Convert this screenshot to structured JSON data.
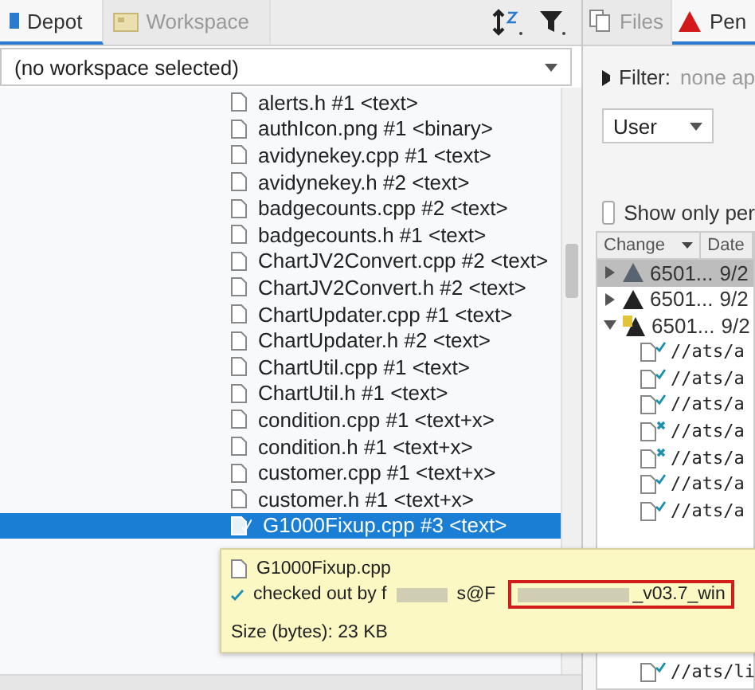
{
  "depot_panel": {
    "tabs": [
      {
        "label": "Depot",
        "selected": true,
        "kind": "depot"
      },
      {
        "label": "Workspace",
        "selected": false,
        "kind": "workspace"
      }
    ],
    "workspace_select": {
      "value": "(no workspace selected)"
    },
    "files": [
      {
        "name": "alerts.h #1 <text>",
        "selected": false,
        "checked_out": false
      },
      {
        "name": "authIcon.png #1 <binary>",
        "selected": false,
        "checked_out": false
      },
      {
        "name": "avidynekey.cpp #1 <text>",
        "selected": false,
        "checked_out": false
      },
      {
        "name": "avidynekey.h #2 <text>",
        "selected": false,
        "checked_out": false
      },
      {
        "name": "badgecounts.cpp #2 <text>",
        "selected": false,
        "checked_out": false
      },
      {
        "name": "badgecounts.h #1 <text>",
        "selected": false,
        "checked_out": false
      },
      {
        "name": "ChartJV2Convert.cpp #2 <text>",
        "selected": false,
        "checked_out": false
      },
      {
        "name": "ChartJV2Convert.h #2 <text>",
        "selected": false,
        "checked_out": false
      },
      {
        "name": "ChartUpdater.cpp #1 <text>",
        "selected": false,
        "checked_out": false
      },
      {
        "name": "ChartUpdater.h #2 <text>",
        "selected": false,
        "checked_out": false
      },
      {
        "name": "ChartUtil.cpp #1 <text>",
        "selected": false,
        "checked_out": false
      },
      {
        "name": "ChartUtil.h #1 <text>",
        "selected": false,
        "checked_out": false
      },
      {
        "name": "condition.cpp #1 <text+x>",
        "selected": false,
        "checked_out": false
      },
      {
        "name": "condition.h #1 <text+x>",
        "selected": false,
        "checked_out": false
      },
      {
        "name": "customer.cpp #1 <text+x>",
        "selected": false,
        "checked_out": false
      },
      {
        "name": "customer.h #1 <text+x>",
        "selected": false,
        "checked_out": false
      },
      {
        "name": "G1000Fixup.cpp #3 <text>",
        "selected": true,
        "checked_out": true
      }
    ],
    "tooltip": {
      "file": "G1000Fixup.cpp",
      "checked_out_prefix": "checked out by f",
      "checked_out_mid": "s@F",
      "checked_out_suffix": "_v03.7_win",
      "size": "Size (bytes): 23 KB"
    }
  },
  "pending_panel": {
    "tabs": [
      {
        "label": "Files",
        "selected": false,
        "kind": "files"
      },
      {
        "label": "Pen",
        "selected": true,
        "kind": "pending"
      }
    ],
    "filter": {
      "label": "Filter:",
      "value": "none ap"
    },
    "user_select": {
      "value": "User"
    },
    "show_only": {
      "label": "Show only per",
      "checked": false
    },
    "columns": [
      "Change",
      "Date"
    ],
    "changes": [
      {
        "number": "6501...",
        "date": "9/2",
        "selected": true,
        "expanded": false,
        "kind": "plain"
      },
      {
        "number": "6501...",
        "date": "9/2",
        "selected": false,
        "expanded": false,
        "kind": "plain"
      },
      {
        "number": "6501...",
        "date": "9/2",
        "selected": false,
        "expanded": true,
        "kind": "open-files"
      }
    ],
    "files": [
      {
        "path": "//ats/a",
        "kind": "edit"
      },
      {
        "path": "//ats/a",
        "kind": "edit"
      },
      {
        "path": "//ats/a",
        "kind": "edit"
      },
      {
        "path": "//ats/a",
        "kind": "delete"
      },
      {
        "path": "//ats/a",
        "kind": "delete"
      },
      {
        "path": "//ats/a",
        "kind": "edit"
      },
      {
        "path": "//ats/a",
        "kind": "edit"
      }
    ],
    "last_file": {
      "path": "//ats/li",
      "kind": "edit"
    }
  }
}
